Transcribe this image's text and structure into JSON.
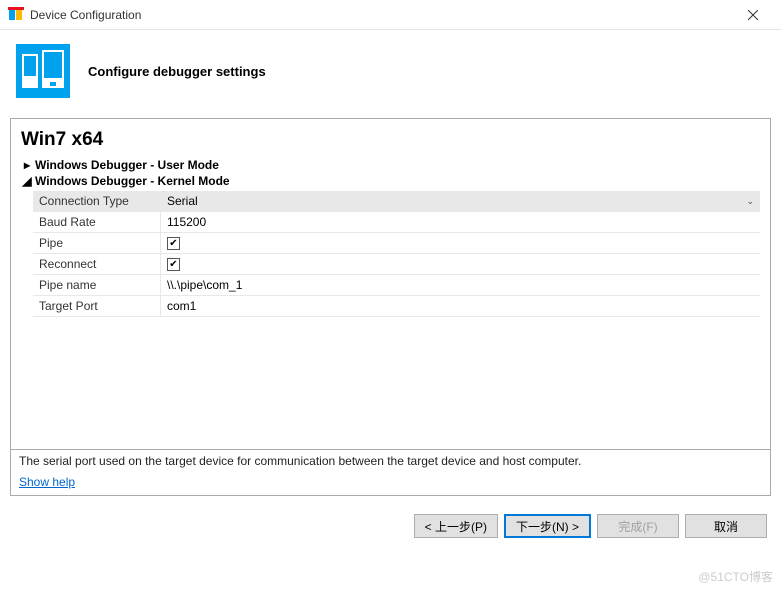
{
  "window": {
    "title": "Device Configuration"
  },
  "header": {
    "title": "Configure debugger settings"
  },
  "device": {
    "name": "Win7 x64"
  },
  "sections": {
    "user_mode": {
      "label": "Windows Debugger - User Mode",
      "expanded": false
    },
    "kernel_mode": {
      "label": "Windows Debugger - Kernel Mode",
      "expanded": true
    }
  },
  "fields": {
    "connection_type": {
      "label": "Connection Type",
      "value": "Serial"
    },
    "baud_rate": {
      "label": "Baud Rate",
      "value": "115200"
    },
    "pipe": {
      "label": "Pipe",
      "checked": true
    },
    "reconnect": {
      "label": "Reconnect",
      "checked": true
    },
    "pipe_name": {
      "label": "Pipe name",
      "value": "\\\\.\\pipe\\com_1"
    },
    "target_port": {
      "label": "Target Port",
      "value": "com1"
    }
  },
  "description": "The serial port used on the target device for communication between the target device and host computer.",
  "show_help": "Show help",
  "buttons": {
    "prev": "< 上一步(P)",
    "next": "下一步(N) >",
    "finish": "完成(F)",
    "cancel": "取消"
  },
  "watermark": "@51CTO博客"
}
